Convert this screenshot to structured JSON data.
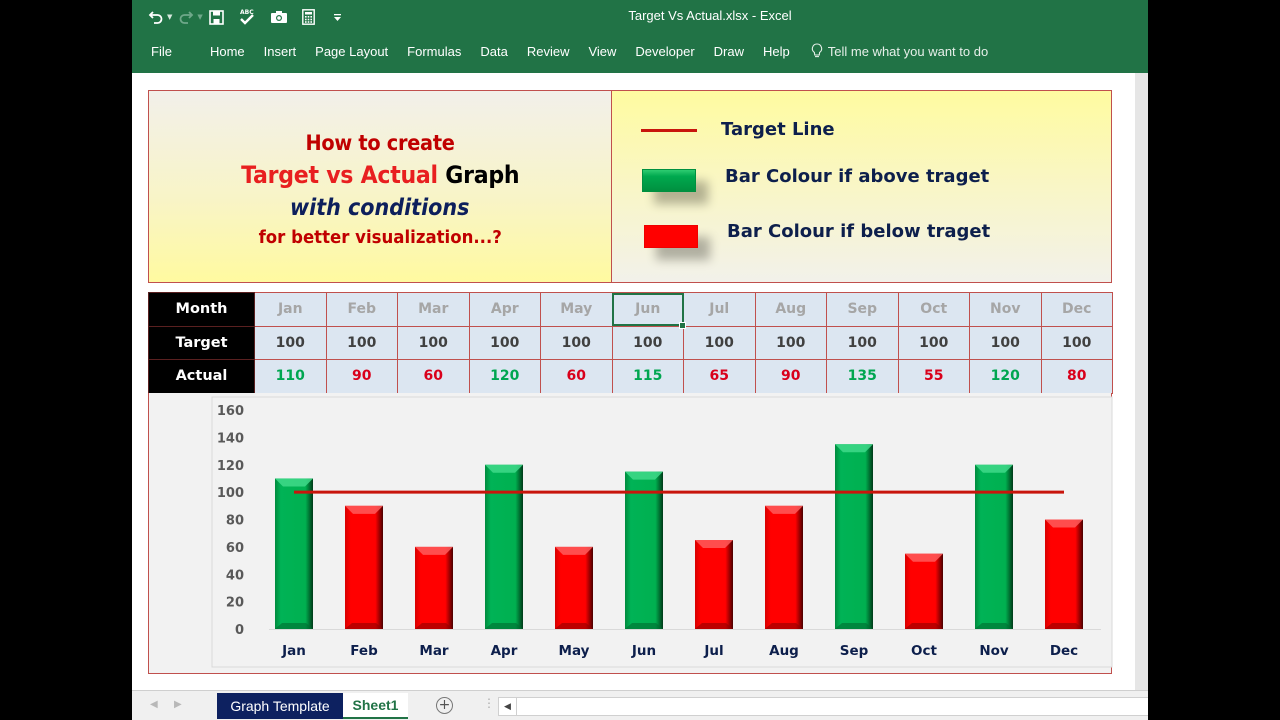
{
  "window": {
    "title": "Target Vs Actual.xlsx  -  Excel"
  },
  "quick_access": [
    {
      "name": "undo-icon",
      "glyph": "↶"
    },
    {
      "name": "redo-icon",
      "glyph": "↷"
    },
    {
      "name": "save-icon",
      "glyph": "💾"
    },
    {
      "name": "spelling-icon",
      "glyph": "ABC✓"
    },
    {
      "name": "camera-icon",
      "glyph": "📷"
    },
    {
      "name": "calculator-icon",
      "glyph": "▦"
    },
    {
      "name": "customize-qat-icon",
      "glyph": "▾"
    }
  ],
  "ribbon": {
    "tabs": [
      "File",
      "Home",
      "Insert",
      "Page Layout",
      "Formulas",
      "Data",
      "Review",
      "View",
      "Developer",
      "Draw",
      "Help"
    ],
    "tell_me": "Tell me what you want to do"
  },
  "banner": {
    "line1": "How to create",
    "line2_red": "Target vs Actual",
    "line2_black": "Graph",
    "line3": "with conditions",
    "line4": "for better visualization...?"
  },
  "legend": {
    "target_line": "Target Line",
    "above": "Bar Colour if above traget",
    "below": "Bar Colour if below traget"
  },
  "colors": {
    "above": "#00b050",
    "below": "#ff0000",
    "target_line": "#c8150c",
    "excel_green": "#217346",
    "header_bg": "#000000",
    "cell_bg": "#dce6f1"
  },
  "table": {
    "row_headers": [
      "Month",
      "Target",
      "Actual"
    ],
    "months": [
      "Jan",
      "Feb",
      "Mar",
      "Apr",
      "May",
      "Jun",
      "Jul",
      "Aug",
      "Sep",
      "Oct",
      "Nov",
      "Dec"
    ],
    "target": [
      "100",
      "100",
      "100",
      "100",
      "100",
      "100",
      "100",
      "100",
      "100",
      "100",
      "100",
      "100"
    ],
    "actual": [
      "110",
      "90",
      "60",
      "120",
      "60",
      "115",
      "65",
      "90",
      "135",
      "55",
      "120",
      "80"
    ],
    "selected_cell": "Jun"
  },
  "chart_data": {
    "type": "bar",
    "title": "",
    "xlabel": "",
    "ylabel": "",
    "categories": [
      "Jan",
      "Feb",
      "Mar",
      "Apr",
      "May",
      "Jun",
      "Jul",
      "Aug",
      "Sep",
      "Oct",
      "Nov",
      "Dec"
    ],
    "series": [
      {
        "name": "Actual",
        "type": "bar",
        "values": [
          110,
          90,
          60,
          120,
          60,
          115,
          65,
          90,
          135,
          55,
          120,
          80
        ]
      },
      {
        "name": "Target",
        "type": "line",
        "values": [
          100,
          100,
          100,
          100,
          100,
          100,
          100,
          100,
          100,
          100,
          100,
          100
        ]
      }
    ],
    "color_rule": "green if Actual > Target, red otherwise",
    "ylim": [
      0,
      160
    ],
    "yticks": [
      0,
      20,
      40,
      60,
      80,
      100,
      120,
      140,
      160
    ],
    "grid": false,
    "legend": "none"
  },
  "sheet_tabs": {
    "tabs": [
      "Graph Template",
      "Sheet1"
    ],
    "active": "Sheet1",
    "add_label": "+"
  }
}
